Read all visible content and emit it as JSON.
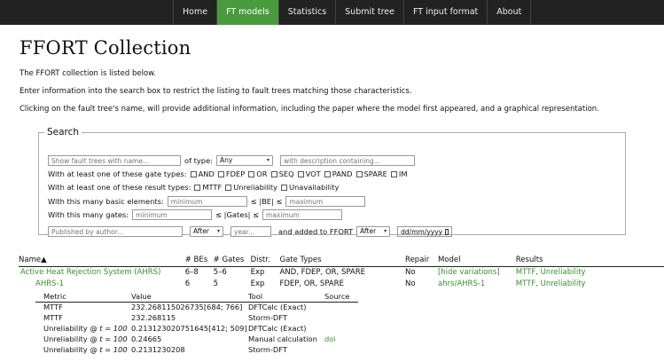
{
  "nav": {
    "items": [
      {
        "label": "Home",
        "active": false
      },
      {
        "label": "FT models",
        "active": true
      },
      {
        "label": "Statistics",
        "active": false
      },
      {
        "label": "Submit tree",
        "active": false
      },
      {
        "label": "FT input format",
        "active": false
      },
      {
        "label": "About",
        "active": false
      }
    ]
  },
  "page": {
    "title": "FFORT Collection",
    "intro1": "The FFORT collection is listed below.",
    "intro2": "Enter information into the search box to restrict the listing to fault trees matching those characteristics.",
    "intro3": "Clicking on the fault tree's name, will provide additional information, including the paper where the model first appeared, and a graphical representation."
  },
  "search": {
    "legend": "Search",
    "name_placeholder": "Show fault trees with name...",
    "of_type_label": "of type:",
    "type_value": "Any",
    "desc_placeholder": "with description containing...",
    "gate_types_label": "With at least one of these gate types:",
    "gate_types": [
      "AND",
      "FDEP",
      "OR",
      "SEQ",
      "VOT",
      "PAND",
      "SPARE",
      "IM"
    ],
    "result_types_label": "With at least one of these result types:",
    "result_types": [
      "MTTF",
      "Unreliability",
      "Unavailability"
    ],
    "be_label": "With this many basic elements:",
    "be_mid": "≤ |BE| ≤",
    "gates_label": "With this many gates:",
    "gates_mid": "≤ |Gates| ≤",
    "min_placeholder": "minimum",
    "max_placeholder": "maximum",
    "author_placeholder": "Published by author...",
    "after_value": "After",
    "year_placeholder": "year...",
    "added_label": "and added to FFORT",
    "date_placeholder": "dd/mm/yyyy"
  },
  "results": {
    "headers": [
      "Name▲",
      "# BEs",
      "# Gates",
      "Distr.",
      "Gate Types",
      "Repair",
      "Model",
      "Results"
    ],
    "rows": [
      {
        "name": "Active Heat Rejection System (AHRS)",
        "bes": "6–8",
        "gates": "5–6",
        "distr": "Exp",
        "gate_types": "AND, FDEP, OR, SPARE",
        "repair": "No",
        "model": "[hide variations]",
        "results": "MTTF, Unreliability"
      },
      {
        "name": "AHRS-1",
        "bes": "6",
        "gates": "5",
        "distr": "Exp",
        "gate_types": "FDEP, OR, SPARE",
        "repair": "No",
        "model": "ahrs/AHRS-1",
        "results": "MTTF, Unreliability"
      }
    ]
  },
  "detail": {
    "headers": [
      "Metric",
      "Value",
      "Tool",
      "Source"
    ],
    "rows": [
      {
        "metric": "MTTF",
        "t": "",
        "value": "232.268115026735[684; 766]",
        "tool": "DFTCalc (Exact)",
        "source": ""
      },
      {
        "metric": "MTTF",
        "t": "",
        "value": "232.268115",
        "tool": "Storm-DFT",
        "source": ""
      },
      {
        "metric": "Unreliability @ ",
        "t": "t = 100",
        "value": "0.213123020751645[412; 509]",
        "tool": "DFTCalc (Exact)",
        "source": ""
      },
      {
        "metric": "Unreliability @ ",
        "t": "t = 100",
        "value": "0.24665",
        "tool": "Manual calculation",
        "source": "doi"
      },
      {
        "metric": "Unreliability @ ",
        "t": "t = 100",
        "value": "0.2131230208",
        "tool": "Storm-DFT",
        "source": ""
      }
    ]
  }
}
